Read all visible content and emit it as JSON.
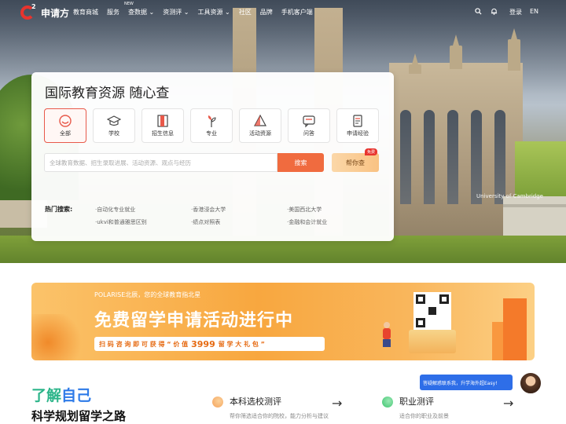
{
  "nav": {
    "logo_text": "申请方",
    "logo_sup": "2",
    "items": [
      "教育商城",
      "服务",
      "查数据 ⌄",
      "资测评 ⌄",
      "工具资源 ⌄",
      "社区",
      "品牌",
      "手机客户端"
    ],
    "new_badge": "NEW",
    "login": "登录",
    "lang": "EN"
  },
  "hero": {
    "watermark": "University of Cambridge"
  },
  "search_card": {
    "title": "国际教育资源 随心查",
    "categories": [
      {
        "label": "全部",
        "icon": "all-icon"
      },
      {
        "label": "学校",
        "icon": "graduation-cap-icon"
      },
      {
        "label": "招生信息",
        "icon": "book-icon"
      },
      {
        "label": "专业",
        "icon": "plant-icon"
      },
      {
        "label": "活动资源",
        "icon": "triangle-icon"
      },
      {
        "label": "问答",
        "icon": "chat-icon"
      },
      {
        "label": "申请经验",
        "icon": "document-icon"
      }
    ],
    "placeholder": "全球教育数据、招生录取进展、活动资源、观点与经历",
    "search_label": "搜索",
    "help_label": "帮你查",
    "help_tag": "免费",
    "hot_label": "热门搜索:",
    "hot_items": [
      "·自动化专业就业",
      "·香港浸会大学",
      "·美国西北大学",
      "·ukvi和普通雅思区别",
      "·绩点对照表",
      "·金融和会计就业"
    ]
  },
  "banner": {
    "sub": "POLARISE北辰，您的全球教育指北星",
    "headline": "免费留学申请活动进行中",
    "pill_prefix": "扫 码 咨 询 即 可 获 得 “ 价 值",
    "pill_number": "3999",
    "pill_suffix": "留 学 大 礼 包 ”"
  },
  "section": {
    "title_part1": "了解",
    "title_part2": "自己",
    "subtitle": "科学规划留学之路",
    "evals": [
      {
        "title": "本科选校测评",
        "desc": "帮你筛选适合你的院校，能力分析与建议",
        "color": "#f5a25a"
      },
      {
        "title": "职业测评",
        "desc": "适合你的职业及前景",
        "color": "#3cc46e"
      }
    ],
    "arrow": "→"
  },
  "chat": {
    "text": "答疑解惑联系我，升学海外超Easy!"
  }
}
